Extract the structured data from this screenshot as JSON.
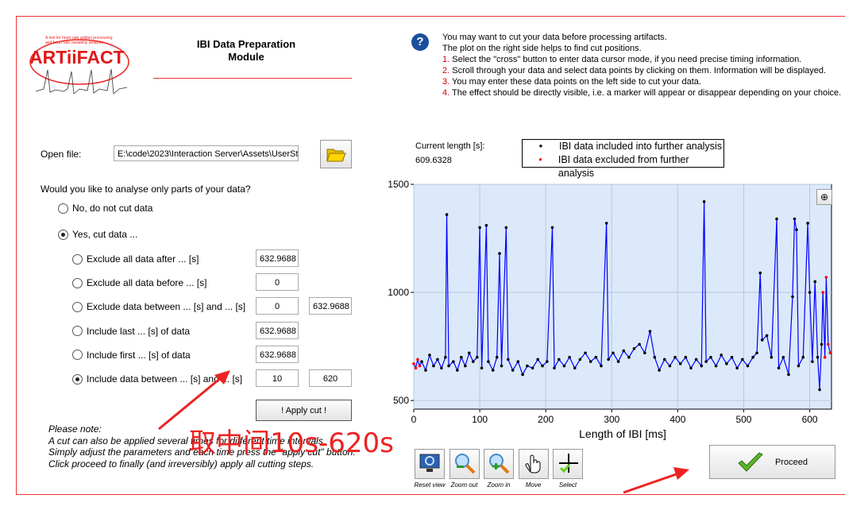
{
  "logo": {
    "text": "ARTiiFACT",
    "tagline": "A tool for heart rate artifact processing and heart rate variability analysis"
  },
  "title": "IBI Data Preparation Module",
  "help_icon": "question-icon",
  "info": {
    "lines": [
      "You may want to cut your data before processing artifacts.",
      "The plot on the right side helps to find cut positions."
    ],
    "steps": [
      {
        "n": "1.",
        "t": " Select the \"cross\" button to enter data cursor mode, if you need precise timing information."
      },
      {
        "n": "2.",
        "t": " Scroll through your data and select data points by clicking on them. Information will be displayed."
      },
      {
        "n": "3.",
        "t": " You may enter these data points on the left side to cut your data."
      },
      {
        "n": "4.",
        "t": " The effect should be directly visible, i.e. a marker will appear or disappear depending on your choice."
      }
    ]
  },
  "open_file": {
    "label": "Open file:",
    "value": "E:\\code\\2023\\Interaction Server\\Assets\\UserStu",
    "icon": "folder-open-icon"
  },
  "question": "Would you like to analyse only parts of your data?",
  "main_options": [
    {
      "label": "No, do not cut data",
      "selected": false
    },
    {
      "label": "Yes, cut data ...",
      "selected": true
    }
  ],
  "cut_options": [
    {
      "label": "Exclude all data after ... [s]",
      "selected": false,
      "v1": "632.9688"
    },
    {
      "label": "Exclude all data before ... [s]",
      "selected": false,
      "v1": "0"
    },
    {
      "label": "Exclude data between ... [s] and ... [s]",
      "selected": false,
      "v1": "0",
      "v2": "632.9688"
    },
    {
      "label": "Include last ... [s] of data",
      "selected": false,
      "v1": "632.9688"
    },
    {
      "label": "Include first ... [s] of data",
      "selected": false,
      "v1": "632.9688"
    },
    {
      "label": "Include data between ... [s] and ... [s]",
      "selected": true,
      "v1": "10",
      "v2": "620"
    }
  ],
  "apply_cut": "!   Apply cut   !",
  "note": [
    "Please note:",
    "A cut can also be applied several times for different time intervals.",
    "Simply adjust the parameters and each time press the \"apply cut\" button.",
    "Click proceed to finally (and irreversibly) apply all cutting steps."
  ],
  "current_length": {
    "label": "Current length [s]:",
    "value": "609.6328"
  },
  "annotation": "取中间10s-620s",
  "tools": [
    {
      "label": "Reset view",
      "icon": "monitor-reset-icon"
    },
    {
      "label": "Zoom out",
      "icon": "zoom-out-icon"
    },
    {
      "label": "Zoom in",
      "icon": "zoom-in-icon"
    },
    {
      "label": "Move",
      "icon": "hand-icon"
    },
    {
      "label": "Select",
      "icon": "crosshair-icon"
    }
  ],
  "proceed": "Proceed",
  "chart_data": {
    "type": "line",
    "xlabel": "Length of IBI [ms]",
    "ylabel": "",
    "xlim": [
      0,
      633
    ],
    "ylim": [
      460,
      1500
    ],
    "xticks": [
      0,
      100,
      200,
      300,
      400,
      500,
      600
    ],
    "yticks": [
      500,
      1000,
      1500
    ],
    "grid": true,
    "legend_placement": "top",
    "colors": {
      "line": "#0000ff",
      "included": "#000000",
      "excluded": "#ff0000",
      "background": "#dbe9fb"
    },
    "series": [
      {
        "name": "IBI data included into further analysis"
      },
      {
        "name": "IBI data excluded from further analysis"
      }
    ],
    "points": [
      [
        0,
        670,
        0
      ],
      [
        3,
        650,
        0
      ],
      [
        6,
        690,
        0
      ],
      [
        9,
        660,
        0
      ],
      [
        12,
        680,
        1
      ],
      [
        18,
        640,
        1
      ],
      [
        24,
        710,
        1
      ],
      [
        30,
        660,
        1
      ],
      [
        36,
        690,
        1
      ],
      [
        42,
        650,
        1
      ],
      [
        48,
        700,
        1
      ],
      [
        50,
        1360,
        1
      ],
      [
        53,
        660,
        1
      ],
      [
        60,
        680,
        1
      ],
      [
        66,
        640,
        1
      ],
      [
        72,
        700,
        1
      ],
      [
        78,
        660,
        1
      ],
      [
        84,
        720,
        1
      ],
      [
        90,
        680,
        1
      ],
      [
        96,
        700,
        1
      ],
      [
        100,
        1300,
        1
      ],
      [
        103,
        650,
        1
      ],
      [
        110,
        1310,
        1
      ],
      [
        113,
        680,
        1
      ],
      [
        120,
        640,
        1
      ],
      [
        126,
        700,
        1
      ],
      [
        130,
        1180,
        1
      ],
      [
        133,
        660,
        1
      ],
      [
        140,
        1300,
        1
      ],
      [
        143,
        690,
        1
      ],
      [
        150,
        640,
        1
      ],
      [
        158,
        680,
        1
      ],
      [
        165,
        620,
        1
      ],
      [
        172,
        660,
        1
      ],
      [
        180,
        650,
        1
      ],
      [
        188,
        690,
        1
      ],
      [
        195,
        660,
        1
      ],
      [
        202,
        680,
        1
      ],
      [
        210,
        1300,
        1
      ],
      [
        213,
        650,
        1
      ],
      [
        220,
        690,
        1
      ],
      [
        228,
        660,
        1
      ],
      [
        236,
        700,
        1
      ],
      [
        244,
        650,
        1
      ],
      [
        252,
        690,
        1
      ],
      [
        260,
        720,
        1
      ],
      [
        268,
        680,
        1
      ],
      [
        276,
        700,
        1
      ],
      [
        284,
        660,
        1
      ],
      [
        292,
        1320,
        1
      ],
      [
        295,
        690,
        1
      ],
      [
        302,
        720,
        1
      ],
      [
        310,
        680,
        1
      ],
      [
        318,
        730,
        1
      ],
      [
        326,
        700,
        1
      ],
      [
        334,
        740,
        1
      ],
      [
        342,
        760,
        1
      ],
      [
        350,
        720,
        1
      ],
      [
        358,
        820,
        1
      ],
      [
        365,
        700,
        1
      ],
      [
        372,
        640,
        1
      ],
      [
        380,
        690,
        1
      ],
      [
        388,
        660,
        1
      ],
      [
        396,
        700,
        1
      ],
      [
        404,
        670,
        1
      ],
      [
        412,
        700,
        1
      ],
      [
        420,
        650,
        1
      ],
      [
        428,
        690,
        1
      ],
      [
        436,
        660,
        1
      ],
      [
        440,
        1420,
        1
      ],
      [
        443,
        680,
        1
      ],
      [
        450,
        700,
        1
      ],
      [
        458,
        660,
        1
      ],
      [
        466,
        710,
        1
      ],
      [
        474,
        670,
        1
      ],
      [
        482,
        700,
        1
      ],
      [
        490,
        650,
        1
      ],
      [
        498,
        690,
        1
      ],
      [
        506,
        660,
        1
      ],
      [
        514,
        700,
        1
      ],
      [
        520,
        720,
        1
      ],
      [
        525,
        1090,
        1
      ],
      [
        528,
        780,
        1
      ],
      [
        535,
        800,
        1
      ],
      [
        542,
        700,
        1
      ],
      [
        550,
        1340,
        1
      ],
      [
        553,
        650,
        1
      ],
      [
        560,
        700,
        1
      ],
      [
        568,
        620,
        1
      ],
      [
        574,
        980,
        1
      ],
      [
        577,
        1340,
        1
      ],
      [
        580,
        1290,
        1
      ],
      [
        583,
        660,
        1
      ],
      [
        590,
        700,
        1
      ],
      [
        597,
        1320,
        1
      ],
      [
        600,
        1000,
        1
      ],
      [
        604,
        680,
        1
      ],
      [
        608,
        1050,
        1
      ],
      [
        612,
        700,
        1
      ],
      [
        615,
        550,
        1
      ],
      [
        618,
        760,
        1
      ],
      [
        620,
        1000,
        0
      ],
      [
        623,
        700,
        0
      ],
      [
        625,
        1070,
        0
      ],
      [
        628,
        760,
        0
      ],
      [
        631,
        720,
        0
      ]
    ]
  }
}
